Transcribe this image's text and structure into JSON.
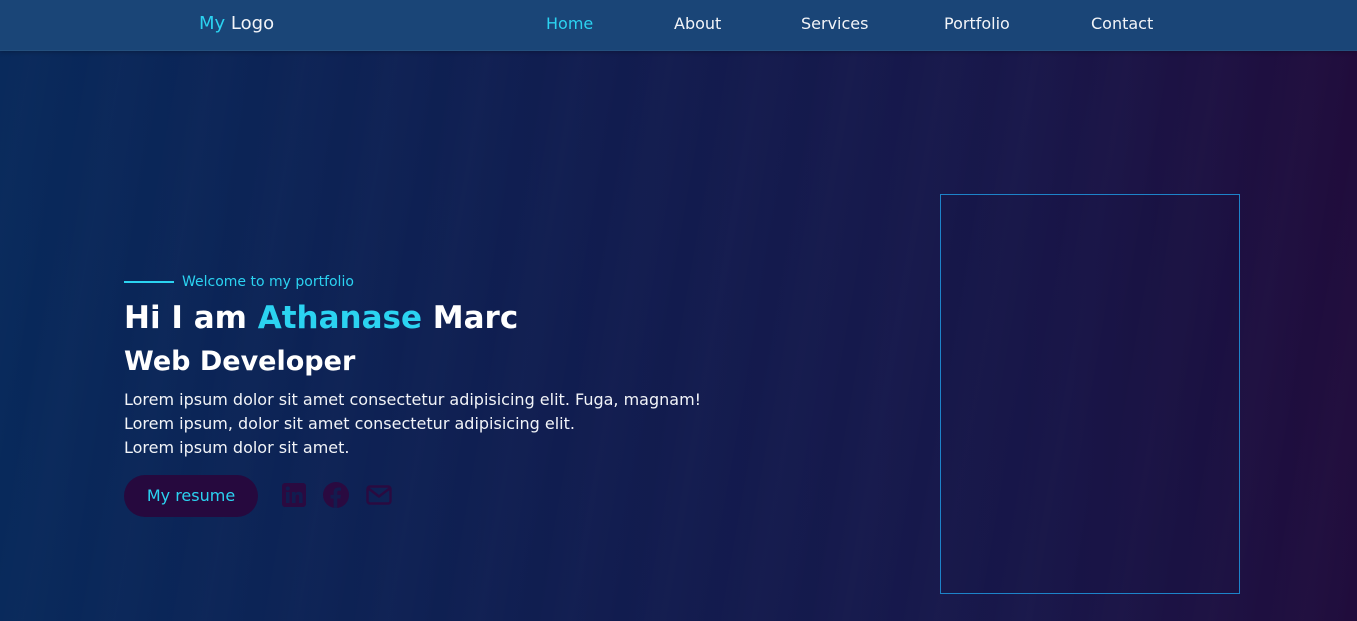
{
  "nav": {
    "logo_accent": "My",
    "logo_rest": "Logo",
    "links": [
      "Home",
      "About",
      "Services",
      "Portfolio",
      "Contact"
    ],
    "active": "Home"
  },
  "hero": {
    "welcome": "Welcome to my portfolio",
    "greeting": "Hi I am",
    "first_name": "Athanase",
    "last_name": "Marc",
    "role": "Web Developer",
    "description": [
      "Lorem ipsum dolor sit amet consectetur adipisicing elit. Fuga, magnam!",
      "Lorem ipsum, dolor sit amet consectetur adipisicing elit.",
      "Lorem ipsum dolor sit amet."
    ],
    "resume_label": "My resume",
    "social_icons": [
      "linkedin-icon",
      "facebook-icon",
      "mail-icon"
    ]
  },
  "colors": {
    "accent": "#2bd3f1",
    "navbar": "#1a4577",
    "button_bg": "#26093e",
    "icon": "#2a0a40",
    "frame_border": "#1d83c9"
  }
}
